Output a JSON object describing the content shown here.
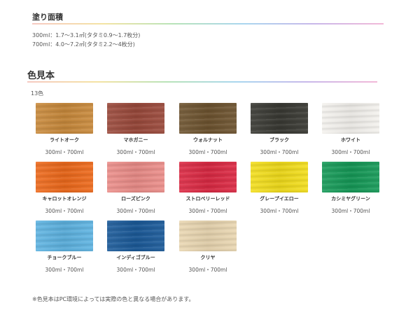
{
  "coverage": {
    "title": "塗り面積",
    "lines": [
      "300ml：1.7〜3.1㎡(タタミ0.9〜1.7枚分)",
      "700ml：4.0〜7.2㎡(タタミ2.2〜4枚分)"
    ]
  },
  "color_samples": {
    "title": "色見本",
    "count": "13色",
    "items": [
      {
        "name": "ライトオーク",
        "sizes": "300ml・700ml",
        "color": "#c98a3c"
      },
      {
        "name": "マホガニー",
        "sizes": "300ml・700ml",
        "color": "#9b4a3c"
      },
      {
        "name": "ウォルナット",
        "sizes": "300ml・700ml",
        "color": "#6e5430"
      },
      {
        "name": "ブラック",
        "sizes": "300ml・700ml",
        "color": "#3a3a34"
      },
      {
        "name": "ホワイト",
        "sizes": "300ml・700ml",
        "color": "#f4f2ee"
      },
      {
        "name": "キャロットオレンジ",
        "sizes": "300ml・700ml",
        "color": "#ee6a1c"
      },
      {
        "name": "ローズピンク",
        "sizes": "300ml・700ml",
        "color": "#ec8e8a"
      },
      {
        "name": "ストロベリーレッド",
        "sizes": "300ml・700ml",
        "color": "#dc2a44"
      },
      {
        "name": "グレープイエロー",
        "sizes": "300ml・700ml",
        "color": "#f3de1c"
      },
      {
        "name": "カシミヤグリーン",
        "sizes": "300ml・700ml",
        "color": "#169a58"
      },
      {
        "name": "チョークブルー",
        "sizes": "300ml・700ml",
        "color": "#5fb4e2"
      },
      {
        "name": "インディゴブルー",
        "sizes": "300ml・700ml",
        "color": "#1c5b9a"
      },
      {
        "name": "クリヤ",
        "sizes": "300ml・700ml",
        "color": "#ead7b2"
      }
    ]
  },
  "note": "※色見本はPC環境によっては実際の色と異なる場合があります。"
}
